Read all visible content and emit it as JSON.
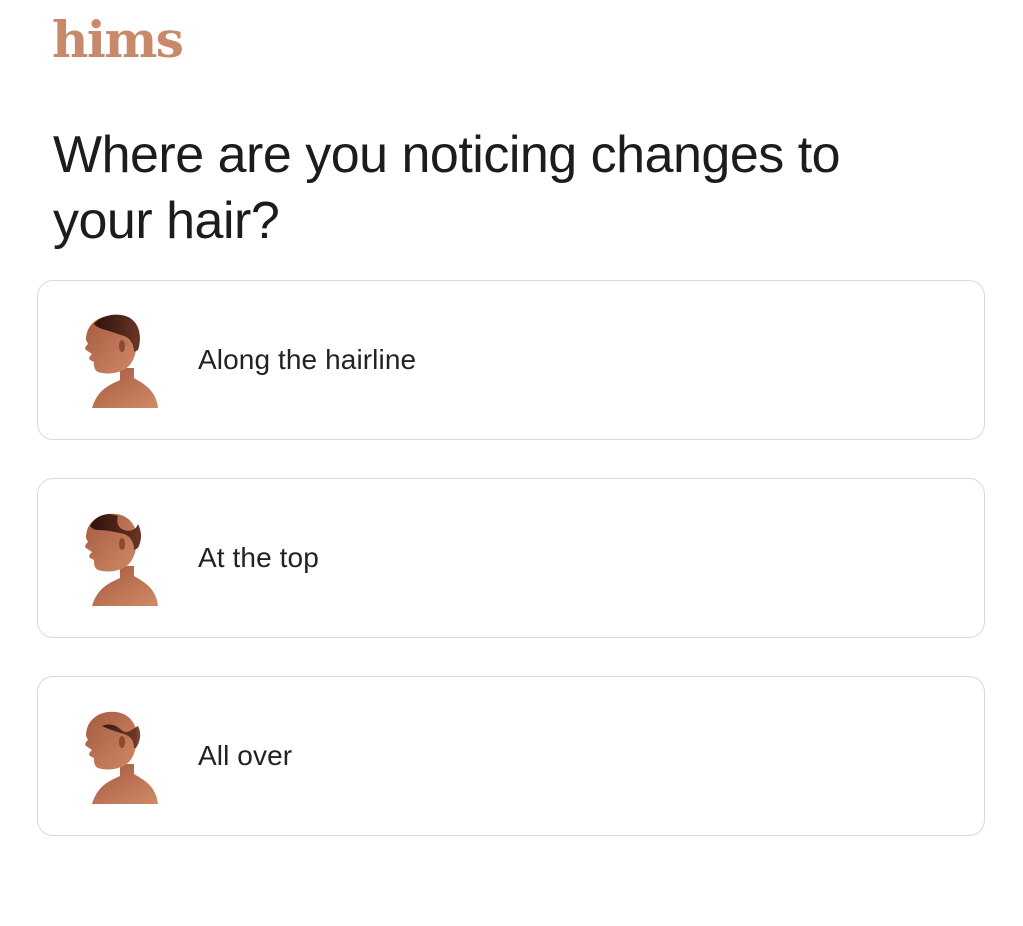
{
  "brand": {
    "logo_text": "hims",
    "logo_color": "#c8896b"
  },
  "question": {
    "title": "Where are you noticing changes to your hair?"
  },
  "options": [
    {
      "label": "Along the hairline",
      "icon": "hairline-head-icon"
    },
    {
      "label": "At the top",
      "icon": "crown-head-icon"
    },
    {
      "label": "All over",
      "icon": "all-over-head-icon"
    }
  ],
  "colors": {
    "skin": "#b5674a",
    "hair": "#3a1a12",
    "border": "#d9d9d9"
  }
}
